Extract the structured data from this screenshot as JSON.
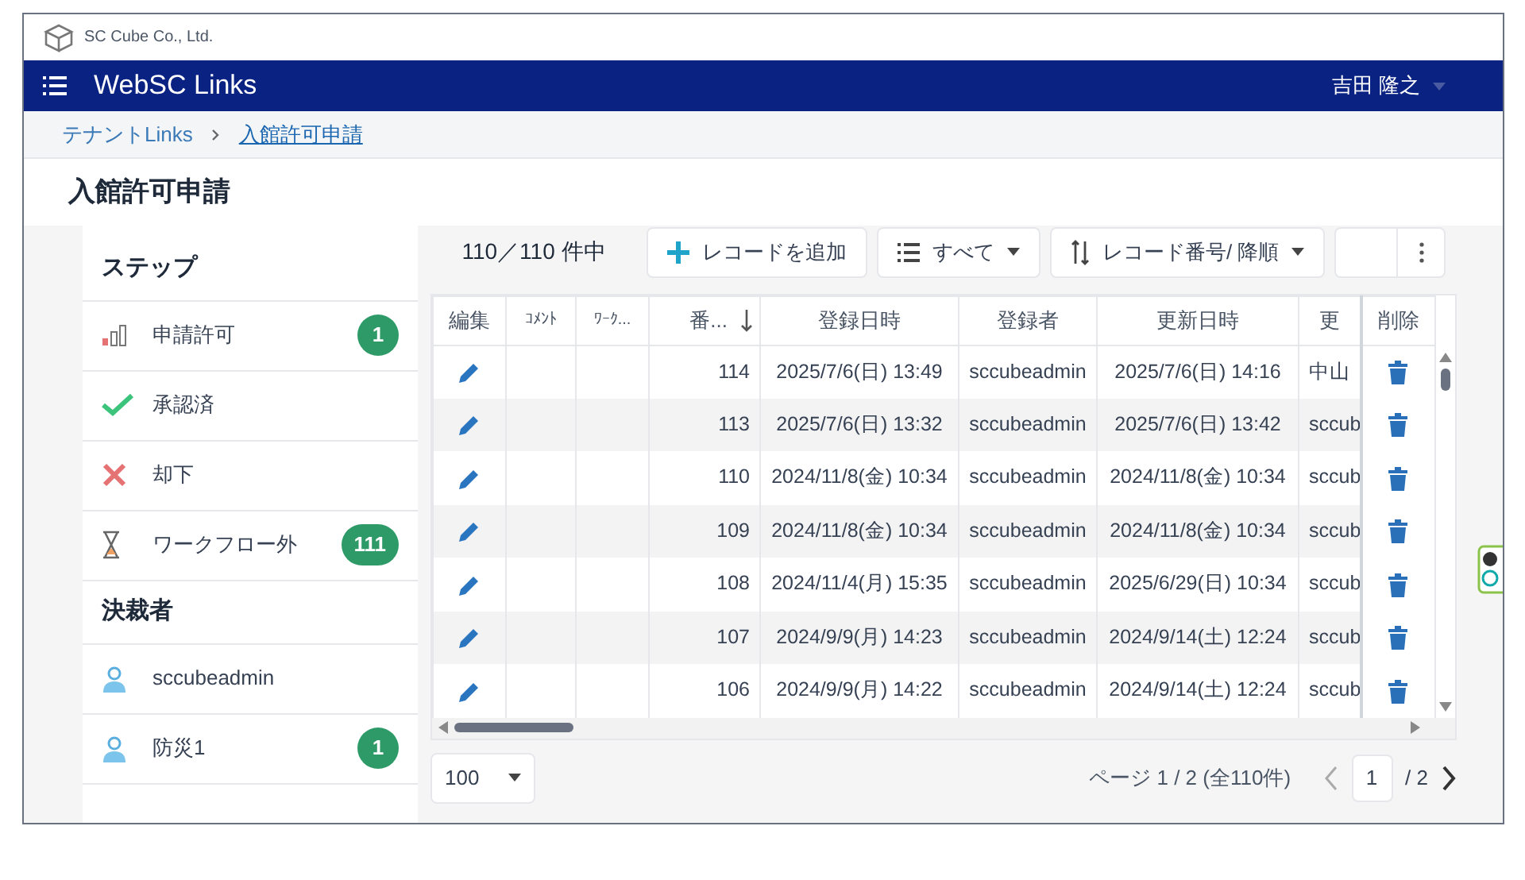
{
  "company": {
    "name": "SC Cube Co., Ltd."
  },
  "navbar": {
    "title": "WebSC Links",
    "user": "吉田 隆之"
  },
  "breadcrumb": [
    {
      "label": "テナントLinks",
      "current": false
    },
    {
      "label": "入館許可申請",
      "current": true
    }
  ],
  "page_title": "入館許可申請",
  "sidebar": {
    "sections": [
      {
        "heading": "ステップ",
        "items": [
          {
            "kind": "bars",
            "label": "申請許可",
            "badge": "1"
          },
          {
            "kind": "check",
            "label": "承認済"
          },
          {
            "kind": "cross",
            "label": "却下"
          },
          {
            "kind": "hourglass",
            "label": "ワークフロー外",
            "badge": "111"
          }
        ]
      },
      {
        "heading": "決裁者",
        "items": [
          {
            "kind": "user",
            "label": "sccubeadmin"
          },
          {
            "kind": "user",
            "label": "防災1",
            "badge": "1"
          }
        ]
      }
    ]
  },
  "toolbar": {
    "count": "110／110 件中",
    "add_button": "レコードを追加",
    "filter": "すべて",
    "sort": "レコード番号/ 降順"
  },
  "table": {
    "columns": [
      {
        "label": "編集",
        "sorted": false
      },
      {
        "label": "ｺﾒﾝﾄ",
        "sorted": false
      },
      {
        "label": "ﾜｰｸ...",
        "sorted": false
      },
      {
        "label": "番...",
        "sorted": true
      },
      {
        "label": "登録日時",
        "sorted": false
      },
      {
        "label": "登録者",
        "sorted": false
      },
      {
        "label": "更新日時",
        "sorted": false
      },
      {
        "label": "更",
        "sorted": false
      },
      {
        "label": "削除",
        "sorted": false
      }
    ],
    "rows": [
      {
        "number": "114",
        "created": "2025/7/6(日) 13:49",
        "creator": "sccubeadmin",
        "updated": "2025/7/6(日) 14:16",
        "updater": "中山"
      },
      {
        "number": "113",
        "created": "2025/7/6(日) 13:32",
        "creator": "sccubeadmin",
        "updated": "2025/7/6(日) 13:42",
        "updater": "sccub"
      },
      {
        "number": "110",
        "created": "2024/11/8(金) 10:34",
        "creator": "sccubeadmin",
        "updated": "2024/11/8(金) 10:34",
        "updater": "sccub"
      },
      {
        "number": "109",
        "created": "2024/11/8(金) 10:34",
        "creator": "sccubeadmin",
        "updated": "2024/11/8(金) 10:34",
        "updater": "sccub"
      },
      {
        "number": "108",
        "created": "2024/11/4(月) 15:35",
        "creator": "sccubeadmin",
        "updated": "2025/6/29(日) 10:34",
        "updater": "sccub"
      },
      {
        "number": "107",
        "created": "2024/9/9(月) 14:23",
        "creator": "sccubeadmin",
        "updated": "2024/9/14(土) 12:24",
        "updater": "sccub"
      },
      {
        "number": "106",
        "created": "2024/9/9(月) 14:22",
        "creator": "sccubeadmin",
        "updated": "2024/9/14(土) 12:24",
        "updater": "sccub"
      }
    ]
  },
  "pager": {
    "page_size": "100",
    "summary": "ページ 1 / 2 (全110件)",
    "page": "1",
    "total": "/ 2"
  }
}
